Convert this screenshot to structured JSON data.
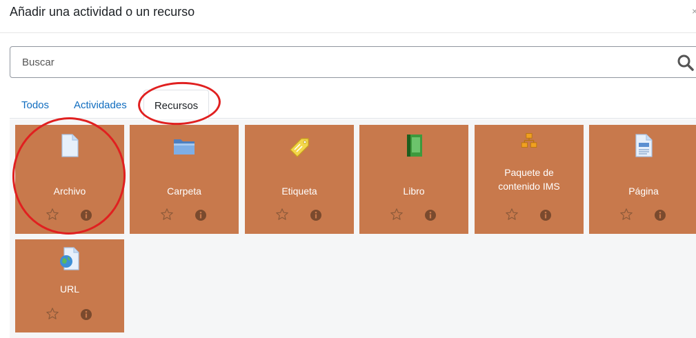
{
  "modal": {
    "title": "Añadir una actividad o un recurso",
    "close_symbol": "×"
  },
  "search": {
    "placeholder": "Buscar",
    "value": ""
  },
  "tabs": [
    {
      "label": "Todos",
      "active": false
    },
    {
      "label": "Actividades",
      "active": false
    },
    {
      "label": "Recursos",
      "active": true
    }
  ],
  "items": [
    {
      "label": "Archivo",
      "icon": "file-icon"
    },
    {
      "label": "Carpeta",
      "icon": "folder-icon"
    },
    {
      "label": "Etiqueta",
      "icon": "tag-icon"
    },
    {
      "label": "Libro",
      "icon": "book-icon"
    },
    {
      "label_line1": "Paquete de",
      "label_line2": "contenido IMS",
      "icon": "package-icon"
    },
    {
      "label": "Página",
      "icon": "page-icon"
    },
    {
      "label": "URL",
      "icon": "url-icon"
    }
  ],
  "colors": {
    "tile_background": "#c8794c",
    "tab_link": "#0f6cbf",
    "annotation_circle": "#e02020"
  }
}
